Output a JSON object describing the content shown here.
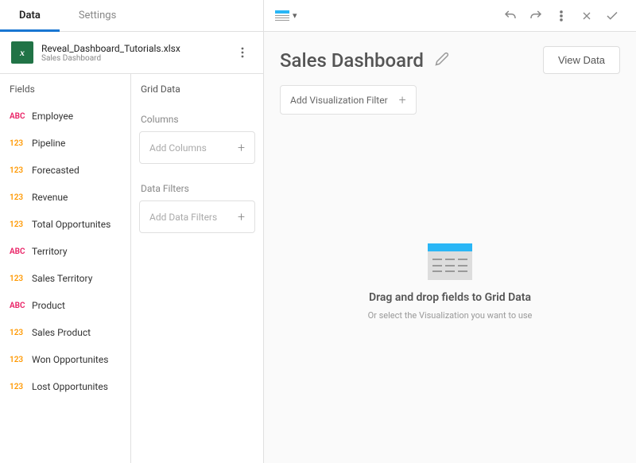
{
  "tabs": {
    "data": "Data",
    "settings": "Settings"
  },
  "file": {
    "name": "Reveal_Dashboard_Tutorials.xlsx",
    "subtitle": "Sales Dashboard"
  },
  "fields": {
    "title": "Fields",
    "items": [
      {
        "type": "ABC",
        "label": "Employee"
      },
      {
        "type": "123",
        "label": "Pipeline"
      },
      {
        "type": "123",
        "label": "Forecasted"
      },
      {
        "type": "123",
        "label": "Revenue"
      },
      {
        "type": "123",
        "label": "Total Opportunites"
      },
      {
        "type": "ABC",
        "label": "Territory"
      },
      {
        "type": "123",
        "label": "Sales Territory"
      },
      {
        "type": "ABC",
        "label": "Product"
      },
      {
        "type": "123",
        "label": "Sales Product"
      },
      {
        "type": "123",
        "label": "Won Opportunites"
      },
      {
        "type": "123",
        "label": "Lost Opportunites"
      }
    ]
  },
  "gridData": {
    "title": "Grid Data",
    "columns": {
      "title": "Columns",
      "placeholder": "Add Columns"
    },
    "filters": {
      "title": "Data Filters",
      "placeholder": "Add Data Filters"
    }
  },
  "header": {
    "title": "Sales Dashboard",
    "viewData": "View Data",
    "addFilter": "Add Visualization Filter"
  },
  "dropArea": {
    "title": "Drag and drop fields to Grid Data",
    "subtitle": "Or select the Visualization you want to use"
  }
}
